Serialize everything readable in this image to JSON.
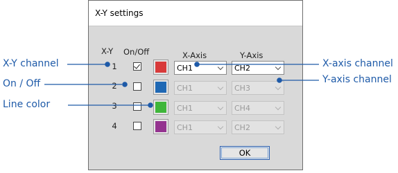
{
  "dialog": {
    "title": "X-Y settings",
    "headers": {
      "xy": "X-Y",
      "onoff": "On/Off",
      "xaxis": "X-Axis",
      "yaxis": "Y-Axis"
    },
    "rows": [
      {
        "num": "1",
        "checked": true,
        "color": "#d83a3a",
        "x": "CH1",
        "y": "CH2"
      },
      {
        "num": "2",
        "checked": false,
        "color": "#1f68b4",
        "x": "CH1",
        "y": "CH3"
      },
      {
        "num": "3",
        "checked": false,
        "color": "#3fb63a",
        "x": "CH1",
        "y": "CH4"
      },
      {
        "num": "4",
        "checked": false,
        "color": "#94338f",
        "x": "CH1",
        "y": "CH2"
      }
    ],
    "ok_label": "OK"
  },
  "callouts": {
    "xy_channel": "X-Y channel",
    "on_off": "On / Off",
    "line_color": "Line color",
    "x_axis_channel": "X-axis channel",
    "y_axis_channel": "Y-axis channel"
  },
  "colors": {
    "callout": "#1e5aa8",
    "dialog_bg": "#d9d9d9",
    "ok_border": "#2a5fb0"
  }
}
